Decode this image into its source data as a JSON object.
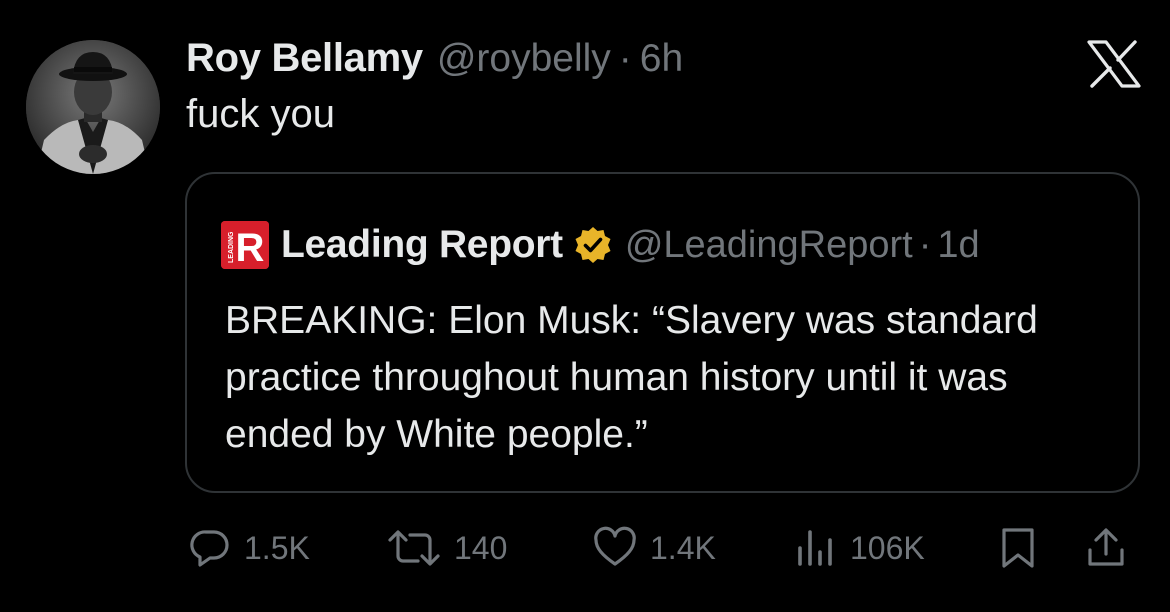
{
  "tweet": {
    "display_name": "Roy Bellamy",
    "handle": "@roybelly",
    "separator": "·",
    "timestamp": "6h",
    "text": "fuck you"
  },
  "quote": {
    "display_name": "Leading Report",
    "handle": "@LeadingReport",
    "separator": "·",
    "timestamp": "1d",
    "logo_letter": "R",
    "logo_vertical_text": "LEADING",
    "text": "BREAKING: Elon Musk: “Slavery was standard practice throughout human history until it was ended by White people.”"
  },
  "actions": {
    "replies": "1.5K",
    "reposts": "140",
    "likes": "1.4K",
    "views": "106K"
  },
  "icons": {
    "platform": "x-logo-icon",
    "verified": "verified-badge-icon",
    "reply": "reply-icon",
    "repost": "repost-icon",
    "like": "heart-icon",
    "views": "views-icon",
    "bookmark": "bookmark-icon",
    "share": "share-icon"
  },
  "colors": {
    "background": "#000000",
    "text_primary": "#e7e9ea",
    "text_secondary": "#71767b",
    "border": "#2f3336",
    "verified_gold": "#e8b429",
    "brand_red": "#d71f2b"
  }
}
